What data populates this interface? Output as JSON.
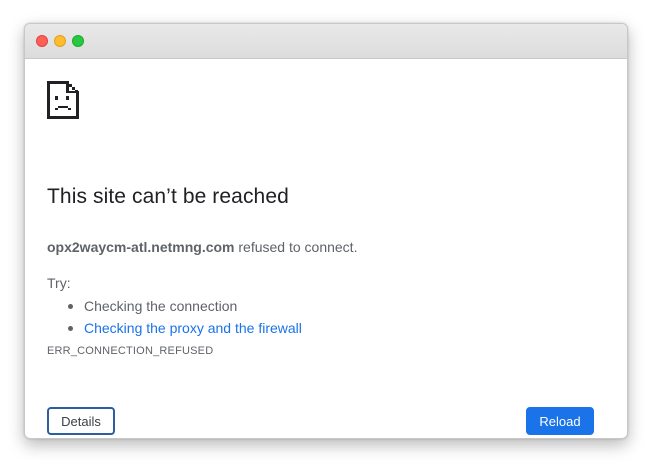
{
  "window": {
    "traffic_lights": [
      "close",
      "minimize",
      "maximize"
    ],
    "colors": {
      "close": "#fe5f57",
      "minimize": "#febc2e",
      "maximize": "#28c840"
    }
  },
  "error_page": {
    "icon": "sad-page-icon",
    "heading": "This site can’t be reached",
    "host": "opx2waycm-atl.netmng.com",
    "host_suffix": " refused to connect.",
    "try_label": "Try:",
    "suggestions": [
      {
        "text": "Checking the connection",
        "is_link": false
      },
      {
        "text": "Checking the proxy and the firewall",
        "is_link": true
      }
    ],
    "error_code": "ERR_CONNECTION_REFUSED",
    "details_label": "Details",
    "reload_label": "Reload",
    "colors": {
      "link": "#1a73e8",
      "primary_button": "#1a73e8",
      "text": "#5f6368",
      "heading": "#202124"
    }
  }
}
